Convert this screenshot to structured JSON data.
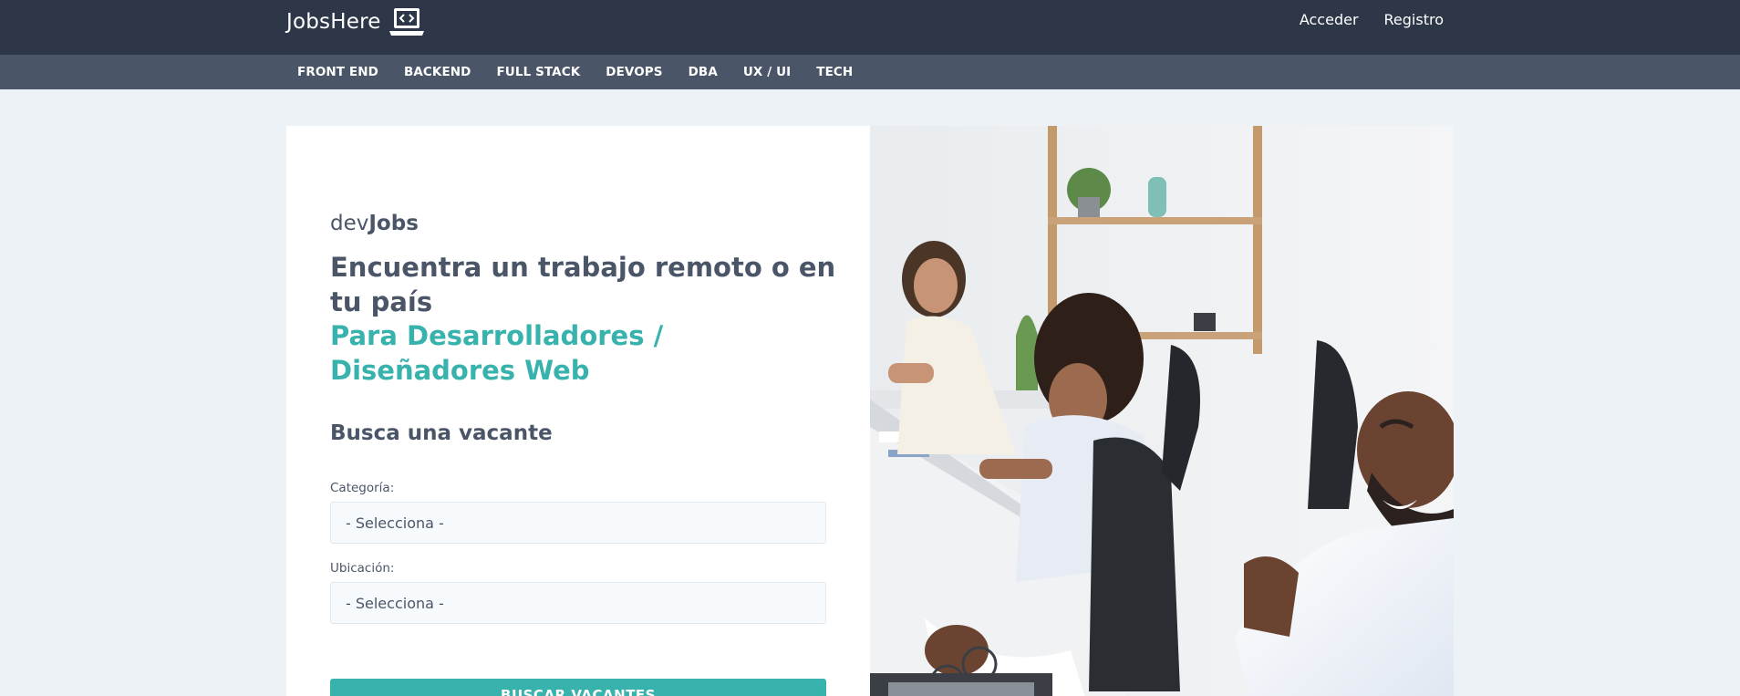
{
  "header": {
    "brand": "JobsHere",
    "brand_icon": "laptop-code-icon",
    "links": {
      "login": "Acceder",
      "register": "Registro"
    }
  },
  "categories": [
    "FRONT END",
    "BACKEND",
    "FULL STACK",
    "DEVOPS",
    "DBA",
    "UX / UI",
    "TECH"
  ],
  "hero": {
    "brand_prefix": "dev",
    "brand_bold": "Jobs",
    "headline": "Encuentra un trabajo remoto o en tu país",
    "subheadline": "Para Desarrolladores / Diseñadores Web",
    "search_title": "Busca una vacante",
    "category_label": "Categoría:",
    "category_value": "- Selecciona -",
    "location_label": "Ubicación:",
    "location_value": "- Selecciona -",
    "search_button": "BUSCAR VACANTES"
  },
  "colors": {
    "topbar": "#2d3748",
    "catbar": "#4a5568",
    "accent": "#38b2ac",
    "background": "#edf2f7"
  }
}
